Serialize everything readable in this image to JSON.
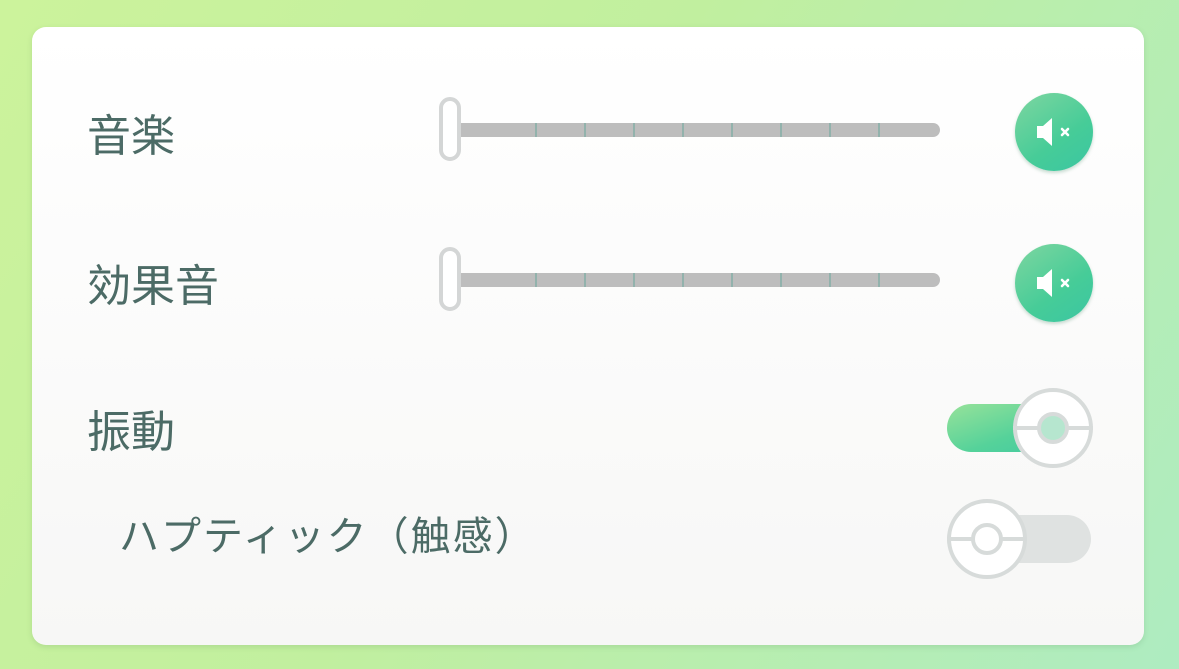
{
  "settings": {
    "music": {
      "label": "音楽",
      "volume": 0,
      "mute_icon": "speaker-muted-icon"
    },
    "sound_effects": {
      "label": "効果音",
      "volume": 0,
      "mute_icon": "speaker-muted-icon"
    },
    "vibration": {
      "label": "振動",
      "enabled": true
    },
    "haptic": {
      "label": "ハプティック（触感）",
      "enabled": false
    }
  },
  "colors": {
    "accent": "#46cc98",
    "label_text": "#4c6b66",
    "track": "#bdbdbd",
    "toggle_off": "#dfe2e1"
  }
}
